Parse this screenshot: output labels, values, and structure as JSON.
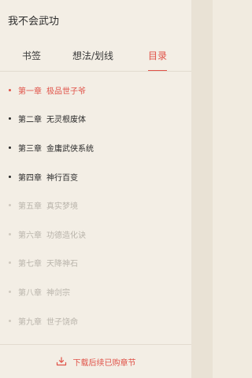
{
  "header": {
    "title": "我不会武功"
  },
  "tabs": [
    {
      "label": "书签",
      "active": false
    },
    {
      "label": "想法/划线",
      "active": false
    },
    {
      "label": "目录",
      "active": true
    }
  ],
  "chapters": [
    {
      "num": "第一章",
      "title": "极品世子爷",
      "state": "active"
    },
    {
      "num": "第二章",
      "title": "无灵根废体",
      "state": "normal"
    },
    {
      "num": "第三章",
      "title": "金庸武侠系统",
      "state": "normal"
    },
    {
      "num": "第四章",
      "title": "神行百变",
      "state": "normal"
    },
    {
      "num": "第五章",
      "title": "真实梦境",
      "state": "locked"
    },
    {
      "num": "第六章",
      "title": "功德造化诀",
      "state": "locked"
    },
    {
      "num": "第七章",
      "title": "天降神石",
      "state": "locked"
    },
    {
      "num": "第八章",
      "title": "神剑宗",
      "state": "locked"
    },
    {
      "num": "第九章",
      "title": "世子饶命",
      "state": "locked"
    },
    {
      "num": "",
      "title": "",
      "state": "locked"
    }
  ],
  "footer": {
    "download_label": "下载后续已购章节"
  },
  "colors": {
    "accent": "#e05248",
    "background": "#f1ebe0",
    "muted": "#b9b4ab"
  }
}
